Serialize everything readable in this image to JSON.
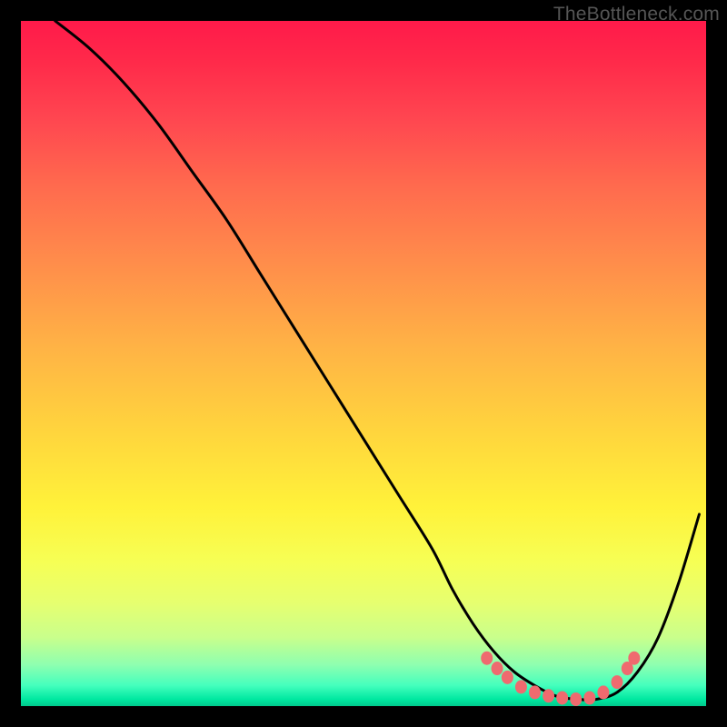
{
  "watermark": "TheBottleneck.com",
  "chart_data": {
    "type": "line",
    "title": "",
    "xlabel": "",
    "ylabel": "",
    "xlim": [
      0,
      100
    ],
    "ylim": [
      0,
      100
    ],
    "background": "red-yellow-green vertical gradient",
    "series": [
      {
        "name": "bottleneck-curve",
        "x": [
          5,
          10,
          15,
          20,
          25,
          30,
          35,
          40,
          45,
          50,
          55,
          60,
          63,
          66,
          69,
          72,
          75,
          78,
          81,
          84,
          87,
          90,
          93,
          96,
          99
        ],
        "values": [
          100,
          96,
          91,
          85,
          78,
          71,
          63,
          55,
          47,
          39,
          31,
          23,
          17,
          12,
          8,
          5,
          3,
          1.5,
          1,
          1,
          2,
          5,
          10,
          18,
          28
        ]
      }
    ],
    "markers": {
      "name": "highlight-dots",
      "color": "#ef6a6f",
      "points": [
        {
          "x": 68,
          "y": 7
        },
        {
          "x": 69.5,
          "y": 5.5
        },
        {
          "x": 71,
          "y": 4.2
        },
        {
          "x": 73,
          "y": 2.8
        },
        {
          "x": 75,
          "y": 2.0
        },
        {
          "x": 77,
          "y": 1.5
        },
        {
          "x": 79,
          "y": 1.2
        },
        {
          "x": 81,
          "y": 1.0
        },
        {
          "x": 83,
          "y": 1.2
        },
        {
          "x": 85,
          "y": 2.0
        },
        {
          "x": 87,
          "y": 3.5
        },
        {
          "x": 88.5,
          "y": 5.5
        },
        {
          "x": 89.5,
          "y": 7
        }
      ]
    },
    "colors": {
      "top": "#ff1a4a",
      "mid": "#fff23a",
      "bottom": "#00c98c",
      "curve": "#000000",
      "markers": "#ef6a6f",
      "frame": "#000000"
    }
  }
}
